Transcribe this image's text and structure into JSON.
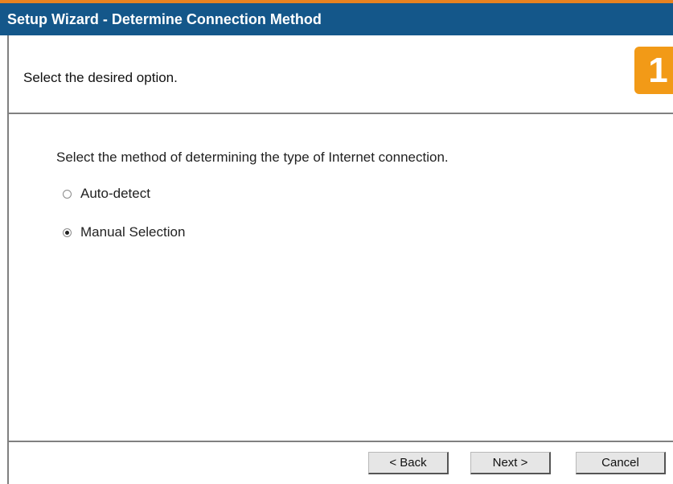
{
  "window": {
    "title": "Setup Wizard - Determine Connection Method"
  },
  "header": {
    "instruction": "Select the desired option.",
    "step_number": "1"
  },
  "main": {
    "prompt": "Select the method of determining the type of Internet connection.",
    "options": [
      {
        "label": "Auto-detect",
        "selected": false
      },
      {
        "label": "Manual Selection",
        "selected": true
      }
    ]
  },
  "footer": {
    "back_label": "< Back",
    "next_label": "Next >",
    "cancel_label": "Cancel"
  },
  "colors": {
    "title_bar": "#14578a",
    "accent": "#e8821f",
    "step_badge": "#f29a17"
  }
}
